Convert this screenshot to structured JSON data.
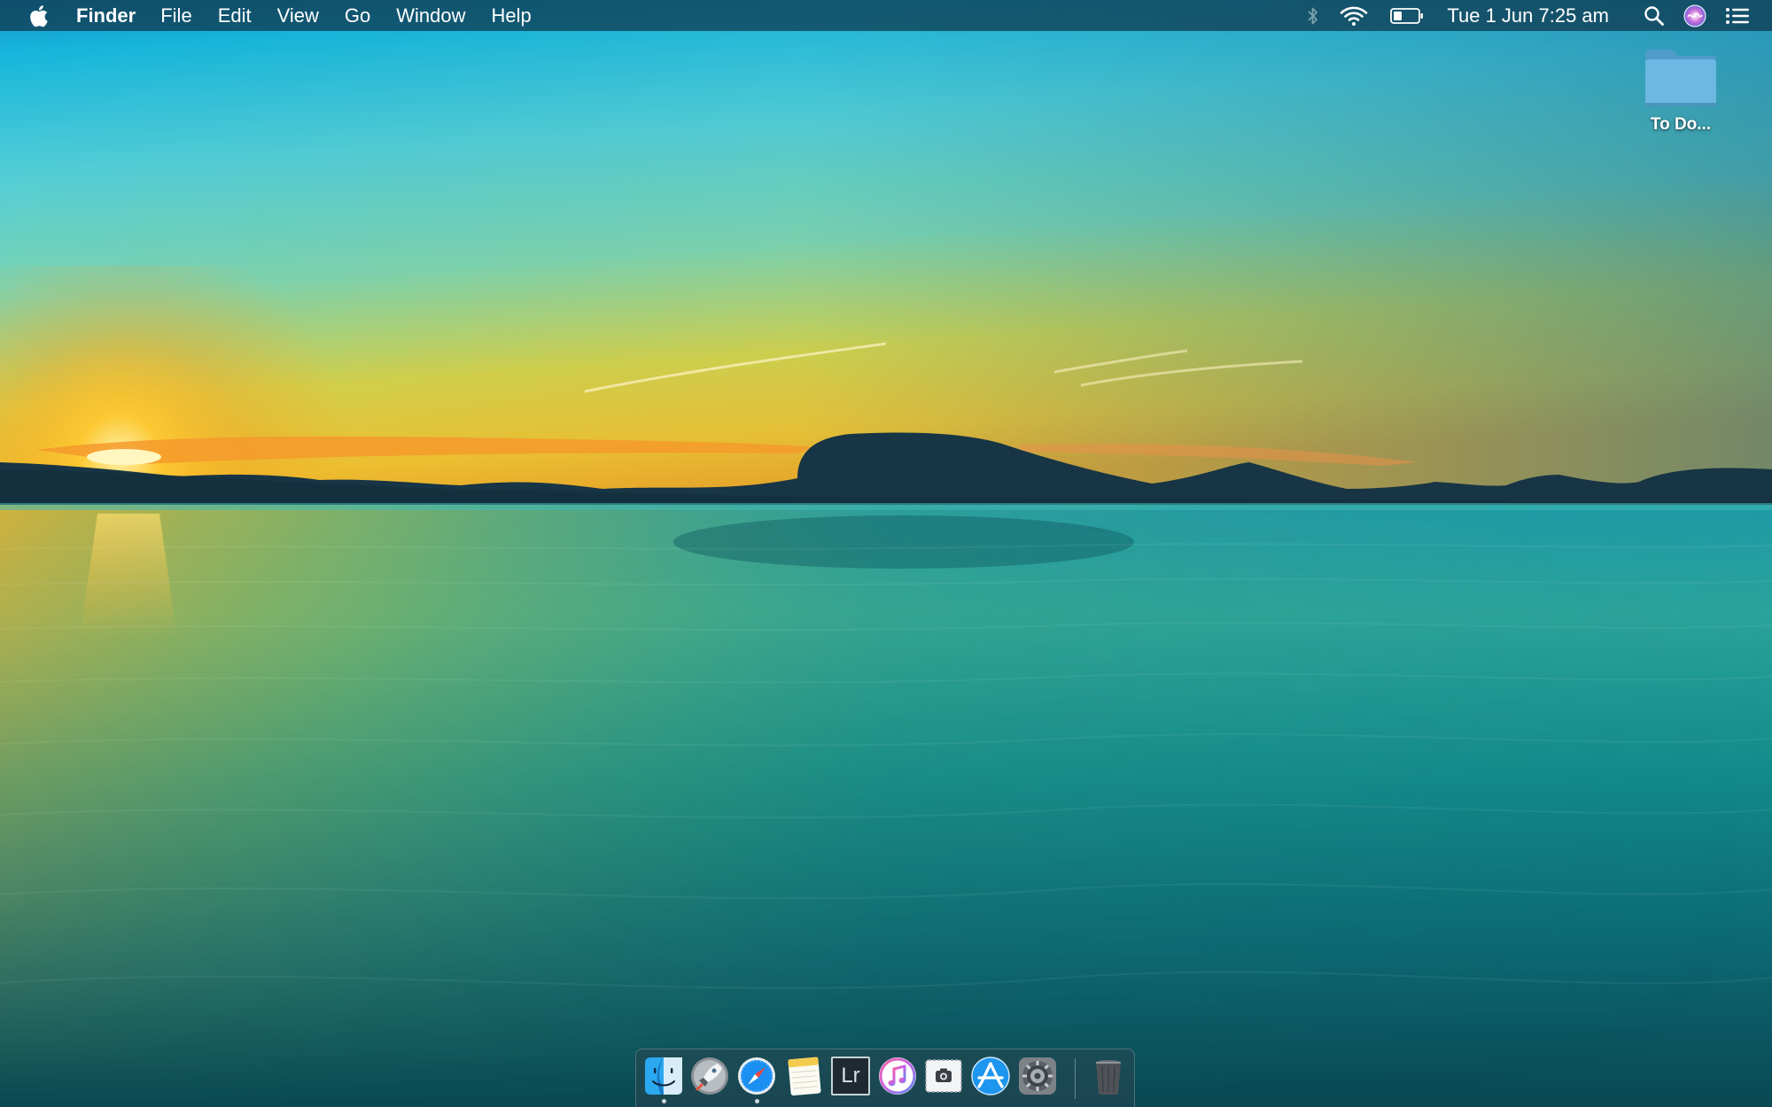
{
  "menubar": {
    "app_name": "Finder",
    "menus": [
      "File",
      "Edit",
      "View",
      "Go",
      "Window",
      "Help"
    ],
    "status_icons": [
      "bluetooth-icon",
      "wifi-icon",
      "battery-icon",
      "spotlight-search-icon",
      "siri-icon",
      "notification-center-icon"
    ],
    "clock": "Tue 1 Jun  7:25 am"
  },
  "desktop": {
    "icons": [
      {
        "label": "To Do...",
        "icon": "folder-icon"
      }
    ]
  },
  "dock": {
    "apps": [
      {
        "icon": "finder-icon",
        "running": true
      },
      {
        "icon": "launchpad-icon",
        "running": false
      },
      {
        "icon": "safari-icon",
        "running": true
      },
      {
        "icon": "notes-icon",
        "running": false
      },
      {
        "icon": "lightroom-icon",
        "running": false,
        "badge_text": "Lr"
      },
      {
        "icon": "itunes-icon",
        "running": false
      },
      {
        "icon": "screenshot-icon",
        "running": false
      },
      {
        "icon": "app-store-icon",
        "running": false
      },
      {
        "icon": "system-preferences-icon",
        "running": false
      },
      {
        "icon": "trash-icon",
        "running": false
      }
    ]
  },
  "colors": {
    "sky_top": "#1590c8",
    "sky_mid": "#5ad0d2",
    "horizon_glow": "#f2c531",
    "sun": "#ffd24a",
    "water_deep": "#0b4d57",
    "mountains": "#183a4a",
    "menubar": "#0e344a"
  }
}
